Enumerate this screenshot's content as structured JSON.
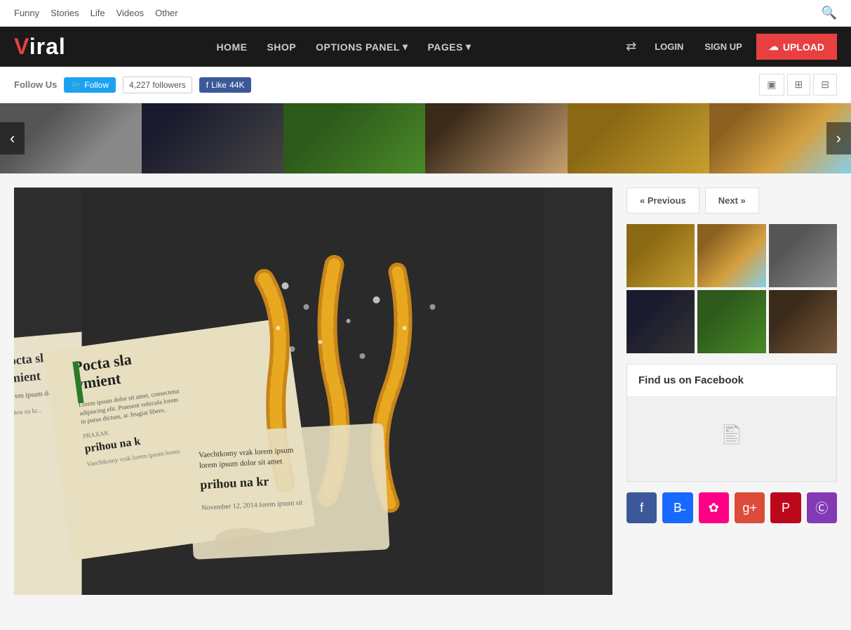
{
  "topNav": {
    "links": [
      "Funny",
      "Stories",
      "Life",
      "Videos",
      "Other"
    ]
  },
  "header": {
    "logo": "Viral",
    "nav": [
      "HOME",
      "SHOP"
    ],
    "dropdowns": [
      "OPTIONS PANEL",
      "PAGES"
    ],
    "loginLabel": "LOGIN",
    "signupLabel": "SIGN UP",
    "uploadLabel": "UPLOAD"
  },
  "followBar": {
    "label": "Follow Us",
    "twitterLabel": "Follow",
    "followersCount": "4,227 followers",
    "fbLikeLabel": "Like",
    "fbCount": "44K"
  },
  "pagination": {
    "prevLabel": "« Previous",
    "nextLabel": "Next »"
  },
  "facebook": {
    "title": "Find us on Facebook"
  },
  "socialIcons": [
    "facebook",
    "behance",
    "flickr",
    "google-plus",
    "pinterest",
    "instagram"
  ],
  "viewToggles": [
    "single",
    "double",
    "grid"
  ]
}
